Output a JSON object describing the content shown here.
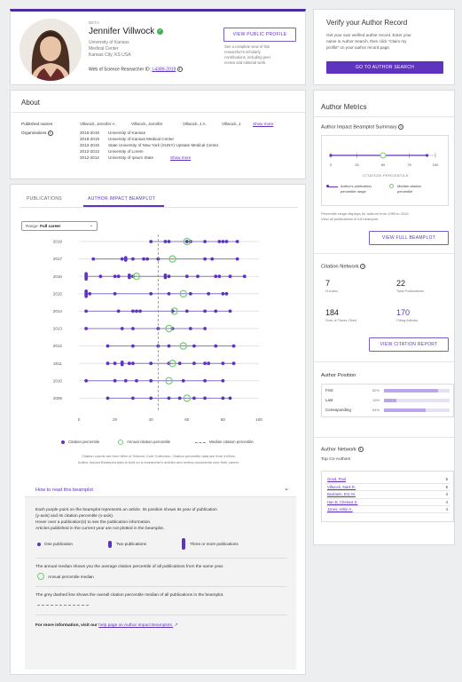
{
  "profile": {
    "beta": "BETA",
    "name": "Jennifer Villwock",
    "affiliations": [
      "University of Kansas",
      "Medical Center",
      "Kansas City, KS USA"
    ],
    "researcher_id_label": "Web of Science Researcher ID:",
    "researcher_id": "I-4389-2019",
    "view_public_profile": "VIEW PUBLIC PROFILE",
    "public_profile_desc": [
      "See a complete view of this",
      "researcher's scholarly",
      "contributions, including peer",
      "review and editorial work."
    ]
  },
  "verify": {
    "title": "Verify your Author Record",
    "desc": [
      "Get your own verified author record. Enter your",
      "name in Author Search, then click \"Claim my",
      "profile\" on your author record page."
    ],
    "button": "GO TO AUTHOR SEARCH"
  },
  "about": {
    "title": "About",
    "published_names_label": "Published names",
    "published_names": [
      "Villwock, Jennifer A.",
      "Villwock, Jennifer",
      "Villwock, J.A.",
      "Villwock, J."
    ],
    "show_more": "Show more",
    "organizations_label": "Organizations",
    "organizations": [
      {
        "years": "2016-2019",
        "name": "University of Kansas"
      },
      {
        "years": "2018-2019",
        "name": "University of Kansas Medical Center"
      },
      {
        "years": "2013-2015",
        "name": "State University of New York (SUNY) Upstate Medical Center"
      },
      {
        "years": "2012-2013",
        "name": "University of Lorem"
      },
      {
        "years": "2012-2012",
        "name": "University of Ipsum State"
      }
    ],
    "org_show_more": "Show more"
  },
  "tabs": {
    "publications": "PUBLICATIONS",
    "beamplot": "AUTHOR IMPACT BEAMPLOT"
  },
  "range": {
    "label": "Range:",
    "value": "Full career"
  },
  "chart_data": {
    "type": "scatter",
    "years": [
      "2019",
      "2017",
      "2016",
      "2015",
      "2014",
      "2013",
      "2012",
      "2011",
      "2010",
      "2009"
    ],
    "xlim": [
      0,
      100
    ],
    "xticks": [
      "0",
      "20",
      "40",
      "60",
      "80",
      "100"
    ],
    "overall_median": 44,
    "rows": [
      {
        "year": "2019",
        "range": [
          40,
          88
        ],
        "points": [
          40,
          48,
          50,
          60,
          62,
          70,
          78,
          80,
          82,
          88
        ],
        "median": 60,
        "doubles": [],
        "triples": []
      },
      {
        "year": "2017",
        "range": [
          8,
          88
        ],
        "points": [
          8,
          24,
          30,
          36,
          38,
          44,
          70,
          74,
          88
        ],
        "median": 52,
        "doubles": [
          26
        ],
        "triples": []
      },
      {
        "year": "2016",
        "range": [
          4,
          92
        ],
        "points": [
          12,
          20,
          22,
          30,
          50,
          60,
          66,
          76,
          78,
          84,
          92
        ],
        "median": 32,
        "doubles": [
          28,
          48
        ],
        "triples": [
          4
        ]
      },
      {
        "year": "2015",
        "range": [
          4,
          82
        ],
        "points": [
          6,
          20,
          40,
          50,
          62,
          72,
          80,
          82
        ],
        "median": 58,
        "doubles": [],
        "triples": [
          4
        ]
      },
      {
        "year": "2014",
        "range": [
          4,
          84
        ],
        "points": [
          4,
          22,
          30,
          32,
          34,
          52,
          60,
          70,
          76,
          84
        ],
        "median": 53,
        "doubles": [],
        "triples": []
      },
      {
        "year": "2013",
        "range": [
          4,
          70
        ],
        "points": [
          4,
          24,
          30,
          44,
          52,
          62,
          70
        ],
        "median": 50,
        "doubles": [],
        "triples": []
      },
      {
        "year": "2012",
        "range": [
          16,
          86
        ],
        "points": [
          16,
          30,
          44,
          50,
          64,
          76,
          86
        ],
        "median": 58,
        "doubles": [],
        "triples": []
      },
      {
        "year": "2011",
        "range": [
          16,
          86
        ],
        "points": [
          16,
          20,
          28,
          30,
          40,
          50,
          56,
          64,
          70,
          72,
          80,
          86
        ],
        "median": 52,
        "doubles": [
          24
        ],
        "triples": []
      },
      {
        "year": "2010",
        "range": [
          4,
          80
        ],
        "points": [
          4,
          20,
          26,
          32,
          40,
          58,
          70,
          80
        ],
        "median": 50,
        "doubles": [],
        "triples": []
      },
      {
        "year": "2009",
        "range": [
          16,
          84
        ],
        "points": [
          16,
          30,
          40,
          50,
          56,
          64,
          70,
          80,
          84
        ],
        "median": 60,
        "doubles": [],
        "triples": []
      }
    ],
    "legend": [
      "Citation percentile",
      "Annual citation percentile",
      "Median citation percentile"
    ],
    "colors": {
      "point": "#5e33bf",
      "median": "#6fcf6f",
      "line": "#8a79c9"
    }
  },
  "beam_footnote": [
    "Citation counts are from Web of Science Core Collection. Citation percentile data are from InCites.",
    "Author Impact Beamplot data is built on a researcher's articles and review documents over their career."
  ],
  "howto": {
    "title": "How to read this beamplot",
    "p1": [
      "Each purple point on the beamplot represents an article. Its position shows its year of publication",
      "(y-axis) and its citation percentile (x-axis).",
      "Hover over a publication(s) to see the publication information.",
      "Articles published in the current year are not plotted in the beamplot."
    ],
    "one": "One publication",
    "two": "Two publications",
    "three": "Three or more publications",
    "p2": "The annual median shows you the average citation percentile of all publications from the same year.",
    "annual": "Annual percentile median",
    "p3": "The grey dashed line shows the overall citation percentile median of all publications in the beamplot.",
    "more_prefix": "For more information, visit our",
    "more_link": "help page on Author Impact Beamplots."
  },
  "metrics": {
    "title": "Author Metrics",
    "beam_summary_title": "Author Impact Beamplot Summary",
    "summary_ticks": [
      "0",
      "25",
      "50",
      "75",
      "100"
    ],
    "summary_axis_label": "CITATION PERCENTILE",
    "summary_range": [
      0,
      92
    ],
    "summary_median": 50,
    "legend_range": [
      "Author's publication",
      "percentile range"
    ],
    "legend_median": [
      "Median citation",
      "percentile"
    ],
    "summary_note": [
      "Percentile range displays for authors from 1980 to 2019.",
      "View all publications in full beamplot."
    ],
    "view_full": "VIEW FULL BEAMPLOT",
    "citation_title": "Citation Network",
    "h_index": "7",
    "h_index_label": "H-Index",
    "total_pubs": "22",
    "total_pubs_label": "Total Publications",
    "times_cited": "184",
    "times_cited_label": "Sum of Times Cited",
    "citing": "170",
    "citing_label": "Citing Articles",
    "view_citation": "VIEW CITATION REPORT",
    "position_title": "Author Position",
    "positions": [
      {
        "label": "First",
        "pct": "82%",
        "value": 0.82
      },
      {
        "label": "Last",
        "pct": "19%",
        "value": 0.19
      },
      {
        "label": "Corresponding",
        "pct": "64%",
        "value": 0.64
      }
    ],
    "network_title": "Author Network",
    "coauthors_title": "Top Co-Authors",
    "coauthors": [
      {
        "name": "Good, Paul",
        "count": "5"
      },
      {
        "name": "Villwock, Mark R.",
        "count": "5"
      },
      {
        "name": "Beahaim, Eric M.",
        "count": "4"
      },
      {
        "name": "Han B, Chelsea S.",
        "count": "4"
      },
      {
        "name": "Jones, Arklin A.",
        "count": "4"
      }
    ]
  }
}
